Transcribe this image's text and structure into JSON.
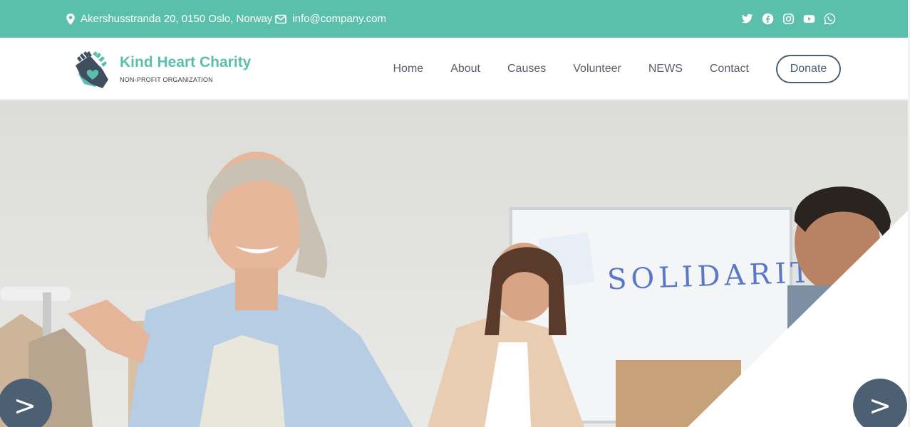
{
  "topbar": {
    "address": "Akershusstranda 20, 0150 Oslo, Norway",
    "email": "info@company.com",
    "icons": {
      "location": "map-pin-icon",
      "email": "envelope-icon"
    },
    "social": [
      "twitter-icon",
      "facebook-icon",
      "instagram-icon",
      "youtube-icon",
      "whatsapp-icon"
    ]
  },
  "brand": {
    "name": "Kind Heart Charity",
    "tagline": "NON-PROFIT ORGANIZATION",
    "logo": "hands-heart-logo"
  },
  "nav": {
    "items": [
      "Home",
      "About",
      "Causes",
      "Volunteer",
      "NEWS",
      "Contact"
    ],
    "donate": "Donate"
  },
  "hero": {
    "whiteboard_text": "SOLIDARITY",
    "prev_label": ">",
    "next_label": ">"
  },
  "colors": {
    "accent": "#5bc0ab",
    "dark": "#4d5f72",
    "nav_text": "#555f69"
  }
}
